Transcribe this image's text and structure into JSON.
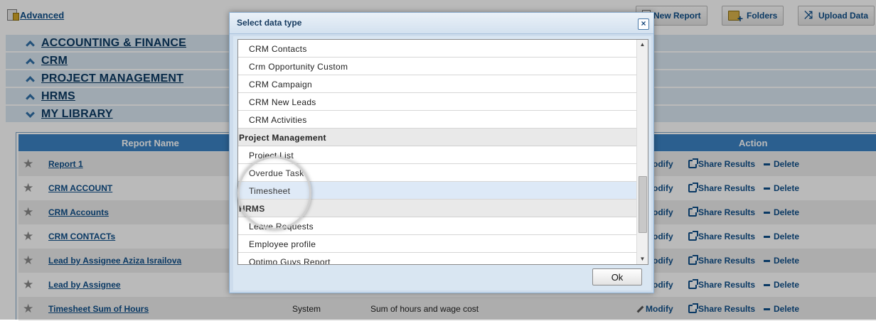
{
  "toolbar": {
    "advanced_label": "Advanced",
    "new_report_label": "New Report",
    "folders_label": "Folders",
    "upload_data_label": "Upload Data"
  },
  "categories": [
    {
      "label": "ACCOUNTING & FINANCE",
      "state": "collapsed"
    },
    {
      "label": "CRM",
      "state": "collapsed"
    },
    {
      "label": "PROJECT MANAGEMENT",
      "state": "collapsed"
    },
    {
      "label": "HRMS",
      "state": "collapsed"
    },
    {
      "label": "MY LIBRARY",
      "state": "expanded"
    }
  ],
  "table": {
    "headers": {
      "name": "Report Name",
      "action": "Action"
    },
    "actions": {
      "modify": "Modify",
      "share": "Share Results",
      "delete": "Delete"
    },
    "rows": [
      {
        "name": "Report 1",
        "type": "",
        "description": ""
      },
      {
        "name": "CRM ACCOUNT",
        "type": "",
        "description": ""
      },
      {
        "name": "CRM Accounts",
        "type": "",
        "description": ""
      },
      {
        "name": "CRM CONTACTs",
        "type": "",
        "description": ""
      },
      {
        "name": "Lead by Assignee Aziza Israilova",
        "type": "",
        "description": ""
      },
      {
        "name": "Lead by Assignee",
        "type": "",
        "description": ""
      },
      {
        "name": "Timesheet Sum of Hours",
        "type": "System",
        "description": "Sum of hours and wage cost"
      }
    ]
  },
  "dialog": {
    "title": "Select data type",
    "close_symbol": "×",
    "ok_label": "Ok",
    "scroll_up_symbol": "▲",
    "scroll_down_symbol": "▼",
    "entries": [
      {
        "kind": "item",
        "label": "CRM Contacts"
      },
      {
        "kind": "item",
        "label": "Crm Opportunity Custom"
      },
      {
        "kind": "item",
        "label": "CRM Campaign"
      },
      {
        "kind": "item",
        "label": "CRM New Leads"
      },
      {
        "kind": "item",
        "label": "CRM Activities"
      },
      {
        "kind": "group",
        "label": "Project Management"
      },
      {
        "kind": "item",
        "label": "Project List"
      },
      {
        "kind": "item",
        "label": "Overdue Task"
      },
      {
        "kind": "item",
        "label": "Timesheet",
        "selected": true
      },
      {
        "kind": "group",
        "label": "HRMS"
      },
      {
        "kind": "item",
        "label": "Leave Requests"
      },
      {
        "kind": "item",
        "label": "Employee profile"
      },
      {
        "kind": "item",
        "label": "Optimo Guys Report"
      }
    ]
  },
  "colors": {
    "header_blue": "#3c83c4",
    "category_bg": "#dbe8f3",
    "link_blue": "#0f4f8a",
    "selection_bg": "#dde9f7"
  }
}
